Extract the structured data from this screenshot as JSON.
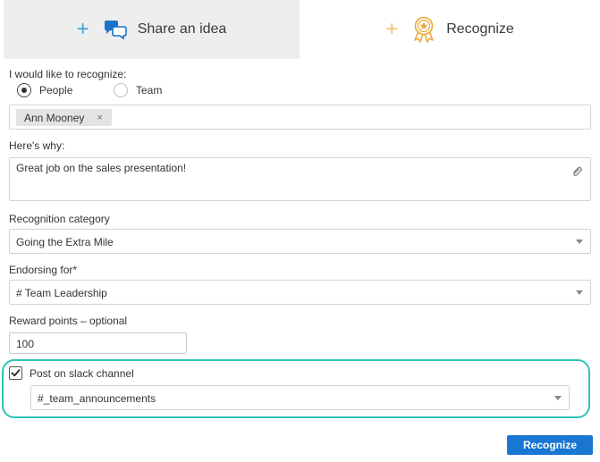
{
  "tabs": [
    {
      "label": "Share an idea",
      "icon": "chat-bubbles-icon"
    },
    {
      "label": "Recognize",
      "icon": "award-ribbon-icon"
    }
  ],
  "recognize_label": "I would like to recognize:",
  "recipient_type": {
    "options": [
      {
        "label": "People",
        "selected": true
      },
      {
        "label": "Team",
        "selected": false
      }
    ]
  },
  "recipients": [
    {
      "name": "Ann Mooney",
      "remove": "×"
    }
  ],
  "reason": {
    "label": "Here's why:",
    "value": "Great job on the sales presentation!"
  },
  "category": {
    "label": "Recognition category",
    "value": "Going the Extra Mile"
  },
  "endorsing": {
    "label": "Endorsing for*",
    "value": "# Team Leadership"
  },
  "reward": {
    "label": "Reward points – optional",
    "value": "100"
  },
  "slack": {
    "label": "Post on slack channel",
    "checked": true,
    "channel": "#_team_announcements"
  },
  "submit_label": "Recognize",
  "colors": {
    "accent": "#1976d2",
    "highlight": "#2ec4b6",
    "share_plus": "#4aa3e0",
    "recognize_plus": "#f5c37a"
  }
}
